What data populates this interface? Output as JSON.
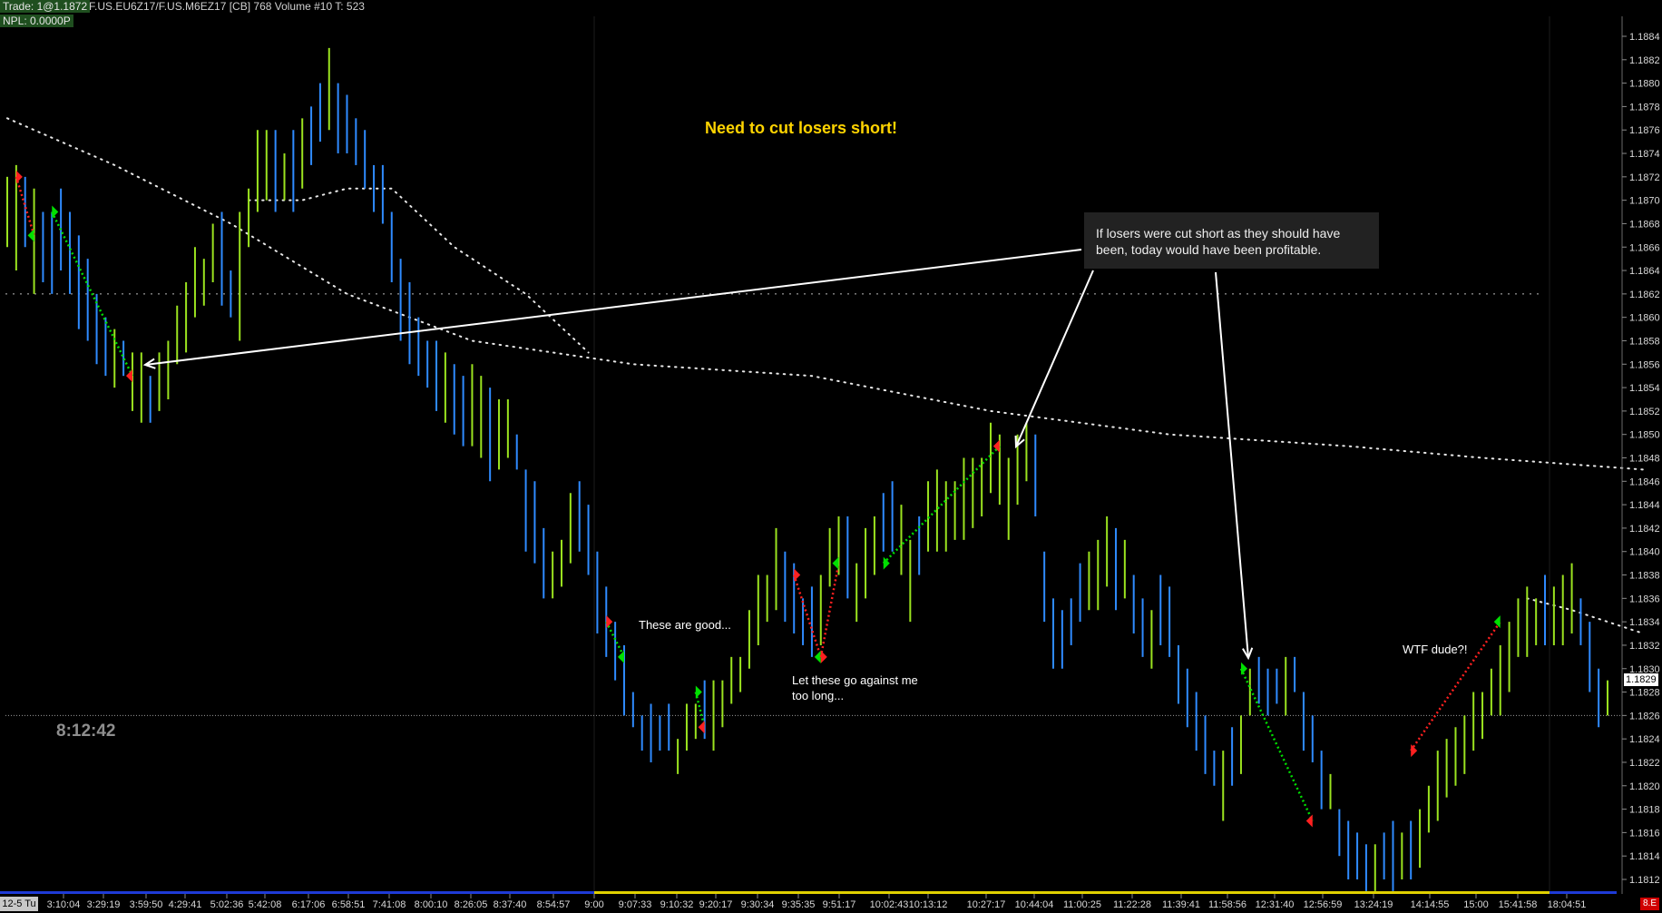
{
  "header": {
    "trade": "Trade: 1@1.1872",
    "symbol_info": "F.US.EU6Z17/F.US.M6EZ17 [CB]  768 Volume  #10 T: 523",
    "npl": "NPL: 0.0000P"
  },
  "annotations": {
    "main": "Need to cut losers short!",
    "callout": "If losers were cut short as they should have been, today would have been profitable.",
    "good": "These are good...",
    "against": "Let these go against me too long...",
    "wtf": "WTF dude?!"
  },
  "clock": "8:12:42",
  "session_label": "12-5 Tu",
  "price_tag": "1.1829",
  "corner_badge": "8.E",
  "colors": {
    "up_bar": "#9be31f",
    "down_bar": "#2f8bff",
    "long_trade": "#00e000",
    "short_trade": "#ff2020",
    "annotation": "#ffd400",
    "background": "#000000",
    "time_axis_bar": "#1e3ad6",
    "time_axis_highlight": "#e0d000"
  },
  "chart_data": {
    "type": "bar",
    "ylim": [
      1.1811,
      1.1886
    ],
    "y_ticks": [
      "1.1884",
      "1.1882",
      "1.1880",
      "1.1878",
      "1.1876",
      "1.1874",
      "1.1872",
      "1.1870",
      "1.1868",
      "1.1866",
      "1.1864",
      "1.1862",
      "1.1860",
      "1.1858",
      "1.1856",
      "1.1854",
      "1.1852",
      "1.1850",
      "1.1848",
      "1.1846",
      "1.1844",
      "1.1842",
      "1.1840",
      "1.1838",
      "1.1836",
      "1.1834",
      "1.1832",
      "1.1830",
      "1.1828",
      "1.1826",
      "1.1824",
      "1.1822",
      "1.1820",
      "1.1818",
      "1.1816",
      "1.1814",
      "1.1812"
    ],
    "x_ticks": [
      "3:10:04",
      "3:29:19",
      "3:59:50",
      "4:29:41",
      "5:02:36",
      "5:42:08",
      "6:17:06",
      "6:58:51",
      "7:41:08",
      "8:00:10",
      "8:26:05",
      "8:37:40",
      "8:54:57",
      "9:00",
      "9:07:33",
      "9:10:32",
      "9:20:17",
      "9:30:34",
      "9:35:35",
      "9:51:17",
      "10:02:43",
      "10:13:12",
      "10:27:17",
      "10:44:04",
      "11:00:25",
      "11:22:28",
      "11:39:41",
      "11:58:56",
      "12:31:40",
      "12:56:59",
      "13:24:19",
      "14:14:55",
      "15:00",
      "15:41:58",
      "18:04:51"
    ],
    "bars": [
      [
        1.1872,
        1.1866,
        "up"
      ],
      [
        1.1873,
        1.1864,
        "up"
      ],
      [
        1.1872,
        1.1866,
        "down"
      ],
      [
        1.1871,
        1.1862,
        "up"
      ],
      [
        1.1869,
        1.1863,
        "down"
      ],
      [
        1.1869,
        1.1862,
        "down"
      ],
      [
        1.1871,
        1.1864,
        "down"
      ],
      [
        1.1869,
        1.1862,
        "down"
      ],
      [
        1.1867,
        1.1859,
        "down"
      ],
      [
        1.1865,
        1.1858,
        "down"
      ],
      [
        1.1862,
        1.1856,
        "down"
      ],
      [
        1.186,
        1.1855,
        "down"
      ],
      [
        1.1859,
        1.1854,
        "up"
      ],
      [
        1.1858,
        1.1855,
        "down"
      ],
      [
        1.1857,
        1.1852,
        "up"
      ],
      [
        1.1857,
        1.1851,
        "up"
      ],
      [
        1.1855,
        1.1851,
        "down"
      ],
      [
        1.1857,
        1.1852,
        "up"
      ],
      [
        1.1858,
        1.1853,
        "up"
      ],
      [
        1.1861,
        1.1856,
        "up"
      ],
      [
        1.1863,
        1.1857,
        "up"
      ],
      [
        1.1866,
        1.186,
        "up"
      ],
      [
        1.1865,
        1.1861,
        "up"
      ],
      [
        1.1868,
        1.1863,
        "up"
      ],
      [
        1.1869,
        1.1861,
        "down"
      ],
      [
        1.1864,
        1.186,
        "down"
      ],
      [
        1.1869,
        1.1858,
        "up"
      ],
      [
        1.1871,
        1.1866,
        "up"
      ],
      [
        1.1876,
        1.1869,
        "up"
      ],
      [
        1.1876,
        1.187,
        "up"
      ],
      [
        1.1876,
        1.1869,
        "down"
      ],
      [
        1.1874,
        1.187,
        "up"
      ],
      [
        1.1876,
        1.1869,
        "down"
      ],
      [
        1.1877,
        1.1871,
        "up"
      ],
      [
        1.1878,
        1.1873,
        "down"
      ],
      [
        1.188,
        1.1875,
        "down"
      ],
      [
        1.1883,
        1.1876,
        "up"
      ],
      [
        1.188,
        1.1874,
        "down"
      ],
      [
        1.1879,
        1.1874,
        "down"
      ],
      [
        1.1877,
        1.1873,
        "down"
      ],
      [
        1.1876,
        1.1871,
        "down"
      ],
      [
        1.1873,
        1.1869,
        "down"
      ],
      [
        1.1873,
        1.1868,
        "down"
      ],
      [
        1.1869,
        1.1863,
        "down"
      ],
      [
        1.1865,
        1.1858,
        "down"
      ],
      [
        1.1863,
        1.1856,
        "down"
      ],
      [
        1.186,
        1.1855,
        "down"
      ],
      [
        1.1858,
        1.1854,
        "down"
      ],
      [
        1.1858,
        1.1852,
        "down"
      ],
      [
        1.1857,
        1.1851,
        "up"
      ],
      [
        1.1856,
        1.185,
        "down"
      ],
      [
        1.1855,
        1.1849,
        "down"
      ],
      [
        1.1856,
        1.1849,
        "up"
      ],
      [
        1.1855,
        1.1848,
        "up"
      ],
      [
        1.1854,
        1.1846,
        "down"
      ],
      [
        1.1853,
        1.1847,
        "up"
      ],
      [
        1.1853,
        1.1848,
        "up"
      ],
      [
        1.185,
        1.1847,
        "down"
      ],
      [
        1.1847,
        1.184,
        "down"
      ],
      [
        1.1846,
        1.1839,
        "down"
      ],
      [
        1.1842,
        1.1836,
        "down"
      ],
      [
        1.184,
        1.1836,
        "up"
      ],
      [
        1.1841,
        1.1837,
        "up"
      ],
      [
        1.1845,
        1.1839,
        "up"
      ],
      [
        1.1846,
        1.184,
        "down"
      ],
      [
        1.1844,
        1.1838,
        "down"
      ],
      [
        1.184,
        1.1833,
        "down"
      ],
      [
        1.1837,
        1.1831,
        "down"
      ],
      [
        1.1834,
        1.1829,
        "down"
      ],
      [
        1.1832,
        1.1826,
        "down"
      ],
      [
        1.1828,
        1.1825,
        "down"
      ],
      [
        1.1826,
        1.1823,
        "down"
      ],
      [
        1.1827,
        1.1822,
        "down"
      ],
      [
        1.1826,
        1.1823,
        "down"
      ],
      [
        1.1827,
        1.1823,
        "down"
      ],
      [
        1.1824,
        1.1821,
        "up"
      ],
      [
        1.1827,
        1.1823,
        "up"
      ],
      [
        1.1827,
        1.1824,
        "up"
      ],
      [
        1.1829,
        1.1824,
        "down"
      ],
      [
        1.1829,
        1.1823,
        "up"
      ],
      [
        1.1829,
        1.1825,
        "up"
      ],
      [
        1.1831,
        1.1827,
        "up"
      ],
      [
        1.1831,
        1.1828,
        "up"
      ],
      [
        1.1835,
        1.183,
        "up"
      ],
      [
        1.1838,
        1.1832,
        "up"
      ],
      [
        1.1838,
        1.1834,
        "up"
      ],
      [
        1.1842,
        1.1835,
        "up"
      ],
      [
        1.184,
        1.1834,
        "down"
      ],
      [
        1.1839,
        1.1833,
        "down"
      ],
      [
        1.1836,
        1.1832,
        "down"
      ],
      [
        1.1837,
        1.1831,
        "down"
      ],
      [
        1.1838,
        1.1832,
        "up"
      ],
      [
        1.1842,
        1.1837,
        "up"
      ],
      [
        1.1843,
        1.1838,
        "up"
      ],
      [
        1.1843,
        1.1836,
        "down"
      ],
      [
        1.1839,
        1.1834,
        "up"
      ],
      [
        1.1842,
        1.1836,
        "up"
      ],
      [
        1.1843,
        1.1838,
        "up"
      ],
      [
        1.1845,
        1.184,
        "down"
      ],
      [
        1.1846,
        1.184,
        "down"
      ],
      [
        1.1844,
        1.1838,
        "up"
      ],
      [
        1.1841,
        1.1834,
        "up"
      ],
      [
        1.1843,
        1.1838,
        "down"
      ],
      [
        1.1846,
        1.184,
        "up"
      ],
      [
        1.1847,
        1.184,
        "up"
      ],
      [
        1.1846,
        1.184,
        "up"
      ],
      [
        1.1846,
        1.1841,
        "up"
      ],
      [
        1.1848,
        1.1841,
        "up"
      ],
      [
        1.1848,
        1.1842,
        "up"
      ],
      [
        1.1848,
        1.1843,
        "up"
      ],
      [
        1.1851,
        1.1845,
        "up"
      ],
      [
        1.185,
        1.1844,
        "up"
      ],
      [
        1.1848,
        1.1841,
        "up"
      ],
      [
        1.185,
        1.1844,
        "up"
      ],
      [
        1.1851,
        1.1846,
        "up"
      ],
      [
        1.185,
        1.1843,
        "down"
      ],
      [
        1.184,
        1.1834,
        "down"
      ],
      [
        1.1836,
        1.183,
        "down"
      ],
      [
        1.1835,
        1.183,
        "down"
      ],
      [
        1.1836,
        1.1832,
        "down"
      ],
      [
        1.1839,
        1.1834,
        "down"
      ],
      [
        1.184,
        1.1835,
        "up"
      ],
      [
        1.1841,
        1.1835,
        "up"
      ],
      [
        1.1843,
        1.1837,
        "up"
      ],
      [
        1.1842,
        1.1835,
        "down"
      ],
      [
        1.1841,
        1.1836,
        "up"
      ],
      [
        1.1838,
        1.1833,
        "down"
      ],
      [
        1.1836,
        1.1831,
        "down"
      ],
      [
        1.1835,
        1.183,
        "up"
      ],
      [
        1.1838,
        1.1832,
        "down"
      ],
      [
        1.1837,
        1.1831,
        "down"
      ],
      [
        1.1832,
        1.1827,
        "down"
      ],
      [
        1.183,
        1.1825,
        "down"
      ],
      [
        1.1828,
        1.1823,
        "down"
      ],
      [
        1.1826,
        1.1821,
        "down"
      ],
      [
        1.1823,
        1.182,
        "down"
      ],
      [
        1.1823,
        1.1817,
        "up"
      ],
      [
        1.1825,
        1.182,
        "down"
      ],
      [
        1.1826,
        1.1821,
        "up"
      ],
      [
        1.183,
        1.1826,
        "up"
      ],
      [
        1.1831,
        1.1827,
        "down"
      ],
      [
        1.183,
        1.1826,
        "down"
      ],
      [
        1.183,
        1.1827,
        "down"
      ],
      [
        1.1831,
        1.1826,
        "up"
      ],
      [
        1.1831,
        1.1828,
        "down"
      ],
      [
        1.1828,
        1.1823,
        "down"
      ],
      [
        1.1826,
        1.1822,
        "down"
      ],
      [
        1.1823,
        1.1818,
        "down"
      ],
      [
        1.1821,
        1.1818,
        "up"
      ],
      [
        1.1818,
        1.1814,
        "down"
      ],
      [
        1.1817,
        1.1812,
        "down"
      ],
      [
        1.1816,
        1.1812,
        "down"
      ],
      [
        1.1815,
        1.1811,
        "down"
      ],
      [
        1.1815,
        1.1811,
        "up"
      ],
      [
        1.1816,
        1.1812,
        "down"
      ],
      [
        1.1817,
        1.1811,
        "down"
      ],
      [
        1.1816,
        1.1812,
        "up"
      ],
      [
        1.1817,
        1.1812,
        "down"
      ],
      [
        1.1818,
        1.1813,
        "up"
      ],
      [
        1.182,
        1.1816,
        "up"
      ],
      [
        1.1823,
        1.1817,
        "up"
      ],
      [
        1.1824,
        1.1819,
        "up"
      ],
      [
        1.1825,
        1.182,
        "up"
      ],
      [
        1.1826,
        1.1821,
        "up"
      ],
      [
        1.1828,
        1.1823,
        "up"
      ],
      [
        1.1828,
        1.1824,
        "up"
      ],
      [
        1.183,
        1.1826,
        "up"
      ],
      [
        1.1832,
        1.1826,
        "up"
      ],
      [
        1.1834,
        1.1828,
        "up"
      ],
      [
        1.1836,
        1.1831,
        "up"
      ],
      [
        1.1837,
        1.1831,
        "up"
      ],
      [
        1.1836,
        1.1832,
        "up"
      ],
      [
        1.1838,
        1.1832,
        "down"
      ],
      [
        1.1837,
        1.1832,
        "up"
      ],
      [
        1.1838,
        1.1832,
        "up"
      ],
      [
        1.1839,
        1.1833,
        "up"
      ],
      [
        1.1836,
        1.1832,
        "down"
      ],
      [
        1.1834,
        1.1828,
        "down"
      ],
      [
        1.183,
        1.1825,
        "down"
      ],
      [
        1.1829,
        1.1826,
        "up"
      ]
    ],
    "ma_slow": [
      [
        0,
        1.1877
      ],
      [
        12,
        1.1873
      ],
      [
        25,
        1.1868
      ],
      [
        38,
        1.1862
      ],
      [
        52,
        1.1858
      ],
      [
        70,
        1.1856
      ],
      [
        90,
        1.1855
      ],
      [
        110,
        1.1852
      ],
      [
        130,
        1.185
      ],
      [
        150,
        1.1849
      ],
      [
        165,
        1.1848
      ],
      [
        183,
        1.1847
      ]
    ],
    "ma_fast": [
      [
        27,
        1.187
      ],
      [
        33,
        1.187
      ],
      [
        38,
        1.1871
      ],
      [
        43,
        1.1871
      ],
      [
        50,
        1.1866
      ],
      [
        58,
        1.1862
      ],
      [
        65,
        1.1857
      ]
    ],
    "ma_tail": [
      [
        170,
        1.1836
      ],
      [
        175,
        1.1835
      ],
      [
        179,
        1.1834
      ],
      [
        183,
        1.1833
      ]
    ],
    "hlines": [
      1.1862,
      1.1826
    ],
    "trades": [
      {
        "entry": [
          1,
          1.1872
        ],
        "exit": [
          3,
          1.1867
        ],
        "side": "short",
        "exit_result": "loss"
      },
      {
        "entry": [
          5,
          1.1869
        ],
        "exit": [
          14,
          1.1855
        ],
        "side": "long",
        "exit_result": "win"
      },
      {
        "entry": [
          67,
          1.1834
        ],
        "exit": [
          69,
          1.1831
        ],
        "side": "short",
        "exit_result": "win"
      },
      {
        "entry": [
          77,
          1.1828
        ],
        "exit": [
          78,
          1.1825
        ],
        "side": "long",
        "exit_result": "win"
      },
      {
        "entry": [
          88,
          1.1838
        ],
        "exit": [
          91,
          1.1831
        ],
        "side": "short",
        "exit_result": "loss"
      },
      {
        "entry": [
          91,
          1.1831
        ],
        "exit": [
          93,
          1.1839
        ],
        "side": "short",
        "exit_result": "loss"
      },
      {
        "entry": [
          98,
          1.1839
        ],
        "exit": [
          111,
          1.1849
        ],
        "side": "long",
        "exit_result": "win"
      },
      {
        "entry": [
          138,
          1.183
        ],
        "exit": [
          146,
          1.1817
        ],
        "side": "long",
        "exit_result": "win"
      },
      {
        "entry": [
          157,
          1.1823
        ],
        "exit": [
          167,
          1.1834
        ],
        "side": "short",
        "exit_result": "loss"
      }
    ]
  }
}
